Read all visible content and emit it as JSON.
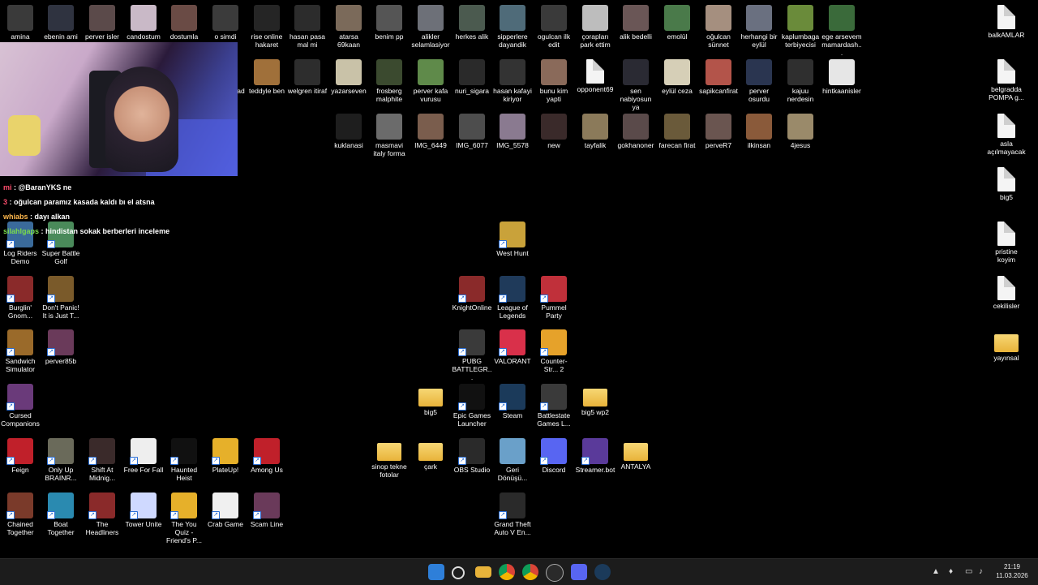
{
  "desktop": {
    "icons": [
      {
        "label": "amina",
        "color": "#3a3a3a"
      },
      {
        "label": "ebenin ami",
        "color": "#2f3340"
      },
      {
        "label": "perver isler",
        "color": "#5b4a4a"
      },
      {
        "label": "candostum",
        "color": "#c9b9c7"
      },
      {
        "label": "dostumla",
        "color": "#6a4b45"
      },
      {
        "label": "o simdi asker",
        "color": "#3b3b3b"
      },
      {
        "label": "rise online hakaret",
        "color": "#252525"
      },
      {
        "label": "hasan pasa mal mi",
        "color": "#2c2c2c"
      },
      {
        "label": "atarsa 69kaan",
        "color": "#7b6a5a"
      },
      {
        "label": "benim pp",
        "color": "#555"
      },
      {
        "label": "alikler selamlasiyor",
        "color": "#6d7078"
      },
      {
        "label": "herkes alik",
        "color": "#4b5a4f"
      },
      {
        "label": "sipperlere dayandik",
        "color": "#4f6b79"
      },
      {
        "label": "ogulcan ilk edit",
        "color": "#3a3a3a"
      },
      {
        "label": "çorapları park ettim",
        "color": "#bdbdbd"
      },
      {
        "label": "alik bedelli",
        "color": "#6a5656"
      },
      {
        "label": "emolül",
        "color": "#4a7a4a"
      },
      {
        "label": "oğulcan sünnet",
        "color": "#a58f7f"
      },
      {
        "label": "herhangi bir eylül",
        "color": "#6a7080"
      },
      {
        "label": "kaplumbaga terbiyecisi",
        "color": "#6a8b3a"
      },
      {
        "label": "ege arsevem mamardash...",
        "color": "#3a6a3a"
      },
      {
        "label": "ad",
        "color": "#000"
      },
      {
        "label": "teddyle ben",
        "color": "#a0703a"
      },
      {
        "label": "welgren itiraf",
        "color": "#2d2d2d"
      },
      {
        "label": "yazarseven",
        "color": "#c9c2a8"
      },
      {
        "label": "frosberg malphite",
        "color": "#3b4a2f"
      },
      {
        "label": "perver kafa vurusu",
        "color": "#5f8a4a"
      },
      {
        "label": "nuri_sigara",
        "color": "#2a2a2a"
      },
      {
        "label": "hasan kafayi kiriyor",
        "color": "#333"
      },
      {
        "label": "bunu kim yapti",
        "color": "#8a6a5a"
      },
      {
        "label": "opponent69",
        "color": "#f0f0f0"
      },
      {
        "label": "sen nabiyosun ya",
        "color": "#2a2a33"
      },
      {
        "label": "eylül ceza",
        "color": "#d6cfb7"
      },
      {
        "label": "sapikcanfirat",
        "color": "#b3544a"
      },
      {
        "label": "perver osurdu",
        "color": "#2a3550"
      },
      {
        "label": "kajuu nerdesin",
        "color": "#2f2f2f"
      },
      {
        "label": "hintkaanisler",
        "color": "#e6e6e6"
      },
      {
        "label": "kuklanasi",
        "color": "#1e1e1e"
      },
      {
        "label": "masmavi italy forma",
        "color": "#6b6b6b"
      },
      {
        "label": "IMG_6449",
        "color": "#7a5d4d"
      },
      {
        "label": "IMG_6077",
        "color": "#4d4d4d"
      },
      {
        "label": "IMG_5578",
        "color": "#8a7a90"
      },
      {
        "label": "new",
        "color": "#3a2a2a"
      },
      {
        "label": "tayfalik",
        "color": "#8b7a5a"
      },
      {
        "label": "gokhanoner",
        "color": "#5a4a4a"
      },
      {
        "label": "farecan firat",
        "color": "#6a5a3a"
      },
      {
        "label": "perveR7",
        "color": "#6a5550"
      },
      {
        "label": "ilkinsan",
        "color": "#8a5a3a"
      },
      {
        "label": "4jesus",
        "color": "#9a8a6a"
      },
      {
        "label": "balkAMLAR",
        "color": "#f4f4f4"
      },
      {
        "label": "belgradda POMPA g...",
        "color": "#f4f4f4"
      },
      {
        "label": "asla açılmayacak",
        "color": "#f4f4f4"
      },
      {
        "label": "big5",
        "color": "#f4f4f4"
      },
      {
        "label": "pristine koyim",
        "color": "#f4f4f4"
      },
      {
        "label": "cekilisler",
        "color": "#f4f4f4"
      },
      {
        "label": "yayınsal",
        "color": "#e8b33a"
      },
      {
        "label": "West Hunt",
        "color": "#c9a23a"
      },
      {
        "label": "Log Riders Demo",
        "color": "#3a6a9a"
      },
      {
        "label": "Super Battle Golf",
        "color": "#4a8a5a"
      },
      {
        "label": "Burglin' Gnom...",
        "color": "#8a2a2a"
      },
      {
        "label": "Don't Panic! It is Just T...",
        "color": "#7a5a2a"
      },
      {
        "label": "Sandwich Simulator",
        "color": "#9a6a2a"
      },
      {
        "label": "perver85b",
        "color": "#6a3a5a"
      },
      {
        "label": "Cursed Companions",
        "color": "#6a3a7a"
      },
      {
        "label": "KnightOnline",
        "color": "#8a2a2a"
      },
      {
        "label": "League of Legends",
        "color": "#1f3a5a"
      },
      {
        "label": "Pummel Party",
        "color": "#c0303a"
      },
      {
        "label": "PUBG BATTLEGR...",
        "color": "#3a3a3a"
      },
      {
        "label": "VALORANT",
        "color": "#d9304a"
      },
      {
        "label": "Counter-Str... 2",
        "color": "#e6a22a"
      },
      {
        "label": "big5",
        "color": "#e8b33a"
      },
      {
        "label": "Epic Games Launcher",
        "color": "#111"
      },
      {
        "label": "Steam",
        "color": "#1b3a5a"
      },
      {
        "label": "Battlestate Games L...",
        "color": "#3a3a3a"
      },
      {
        "label": "big5 wp2",
        "color": "#f7d774"
      },
      {
        "label": "sinop tekne fotolar",
        "color": "#e8b33a"
      },
      {
        "label": "çark",
        "color": "#e8b33a"
      },
      {
        "label": "OBS Studio",
        "color": "#2a2a2a"
      },
      {
        "label": "Geri Dönüşü...",
        "color": "#6aa0c9"
      },
      {
        "label": "Discord",
        "color": "#5865f2"
      },
      {
        "label": "Streamer.bot",
        "color": "#5a3a9a"
      },
      {
        "label": "ANTALYA",
        "color": "#e8b33a"
      },
      {
        "label": "Feign",
        "color": "#c0202a"
      },
      {
        "label": "Only Up BRAINR...",
        "color": "#6a6a5a"
      },
      {
        "label": "Shift At Midnig...",
        "color": "#3a2a2a"
      },
      {
        "label": "Free For Fall",
        "color": "#eee"
      },
      {
        "label": "Haunted Heist",
        "color": "#111"
      },
      {
        "label": "PlateUp!",
        "color": "#e6b02a"
      },
      {
        "label": "Among Us",
        "color": "#c0202a"
      },
      {
        "label": "Grand Theft Auto V En...",
        "color": "#2a2a2a"
      },
      {
        "label": "Chained Together",
        "color": "#7a3a2a"
      },
      {
        "label": "Boat Together",
        "color": "#2a8ab0"
      },
      {
        "label": "The Headliners",
        "color": "#8a2a2a"
      },
      {
        "label": "Tower Unite",
        "color": "#cfd9ff"
      },
      {
        "label": "The You Quiz - Friend's P...",
        "color": "#e6b02a"
      },
      {
        "label": "Crab Game",
        "color": "#f0f0f0"
      },
      {
        "label": "Scam Line",
        "color": "#6a3a5a"
      }
    ]
  },
  "chat": {
    "lines": [
      {
        "user": "mi",
        "user_color": "#ff4d6d",
        "text": " : @BaranYKS ne"
      },
      {
        "user": "3",
        "user_color": "#ff4d6d",
        "text": " : oğulcan paramız kasada kaldı bı el atsna"
      },
      {
        "user": "whiabs",
        "user_color": "#ffb84d",
        "text": " : dayı alkan"
      },
      {
        "user": "silahlgaps",
        "user_color": "#7bdc4b",
        "text": " : hindistan sokak berberleri inceleme"
      }
    ]
  },
  "taskbar": {
    "apps": [
      "start-icon",
      "search-icon",
      "file-explorer-icon",
      "chrome-icon",
      "chrome-profile-icon",
      "obs-icon",
      "discord-icon",
      "steam-icon"
    ],
    "clock_time": "21:19",
    "clock_date": "11.03.2026"
  }
}
